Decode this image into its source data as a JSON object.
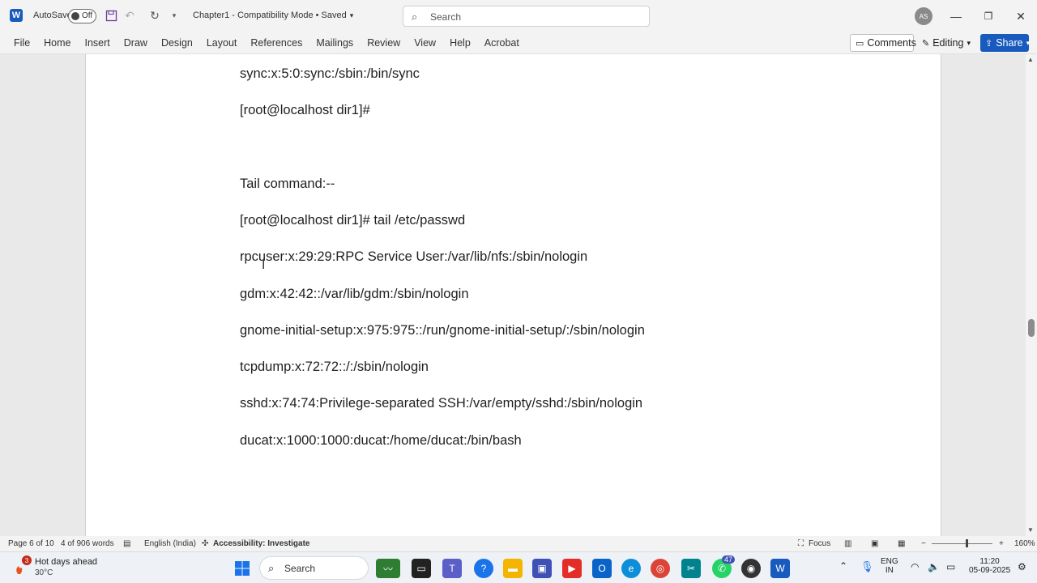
{
  "titlebar": {
    "autosave_label": "AutoSave",
    "autosave_state": "Off",
    "doc_title": "Chapter1  -  Compatibility Mode  •  Saved",
    "search_placeholder": "Search",
    "avatar_initials": "AS",
    "icons": [
      "word-logo-icon",
      "save-icon",
      "undo-icon",
      "redo-icon",
      "customize-qat-icon",
      "minimize-icon",
      "restore-icon",
      "close-icon"
    ]
  },
  "ribbon": {
    "tabs": [
      "File",
      "Home",
      "Insert",
      "Draw",
      "Design",
      "Layout",
      "References",
      "Mailings",
      "Review",
      "View",
      "Help",
      "Acrobat"
    ],
    "comments_label": "Comments",
    "editing_label": "Editing",
    "share_label": "Share"
  },
  "document": {
    "lines": [
      "sync:x:5:0:sync:/sbin:/bin/sync",
      "[root@localhost dir1]#",
      "Tail command:--",
      "[root@localhost dir1]# tail /etc/passwd",
      "rpcuser:x:29:29:RPC Service User:/var/lib/nfs:/sbin/nologin",
      "gdm:x:42:42::/var/lib/gdm:/sbin/nologin",
      "gnome-initial-setup:x:975:975::/run/gnome-initial-setup/:/sbin/nologin",
      "tcpdump:x:72:72::/:/sbin/nologin",
      "sshd:x:74:74:Privilege-separated SSH:/var/empty/sshd:/sbin/nologin",
      "ducat:x:1000:1000:ducat:/home/ducat:/bin/bash"
    ]
  },
  "statusbar": {
    "page": "Page 6 of 10",
    "words": "4 of 906 words",
    "language": "English (India)",
    "accessibility": "Accessibility: Investigate",
    "focus": "Focus",
    "zoom": "160%"
  },
  "taskbar": {
    "weather_title": "Hot days ahead",
    "weather_temp": "30°C",
    "weather_badge": "3",
    "search_placeholder": "Search",
    "language_line1": "ENG",
    "language_line2": "IN",
    "time": "11:20",
    "date": "05-09-2025",
    "badge_count": "47",
    "accent": "#185abd"
  }
}
